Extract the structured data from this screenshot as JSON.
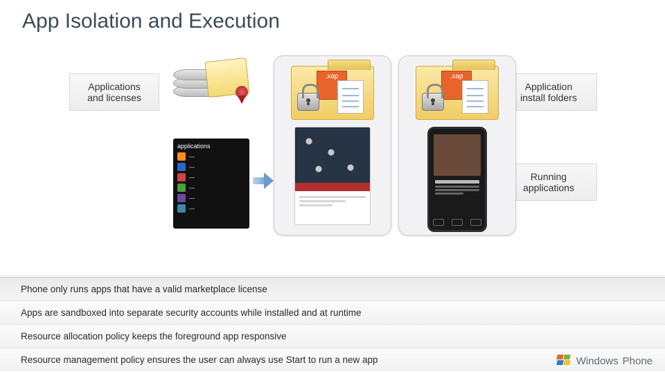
{
  "title": "App Isolation and Execution",
  "labels": {
    "apps_licenses": "Applications and licenses",
    "install_folders": "Application install folders",
    "running_apps": "Running applications"
  },
  "xap_tag": ".xap",
  "phone_list_title": "applications",
  "bullets": [
    "Phone only runs apps that have a valid marketplace license",
    "Apps are sandboxed into separate security accounts while installed and at runtime",
    "Resource allocation policy keeps the foreground app responsive",
    "Resource management policy ensures the user can always use Start to run a new app"
  ],
  "brand": {
    "windows": "Windows",
    "phone": "Phone"
  }
}
